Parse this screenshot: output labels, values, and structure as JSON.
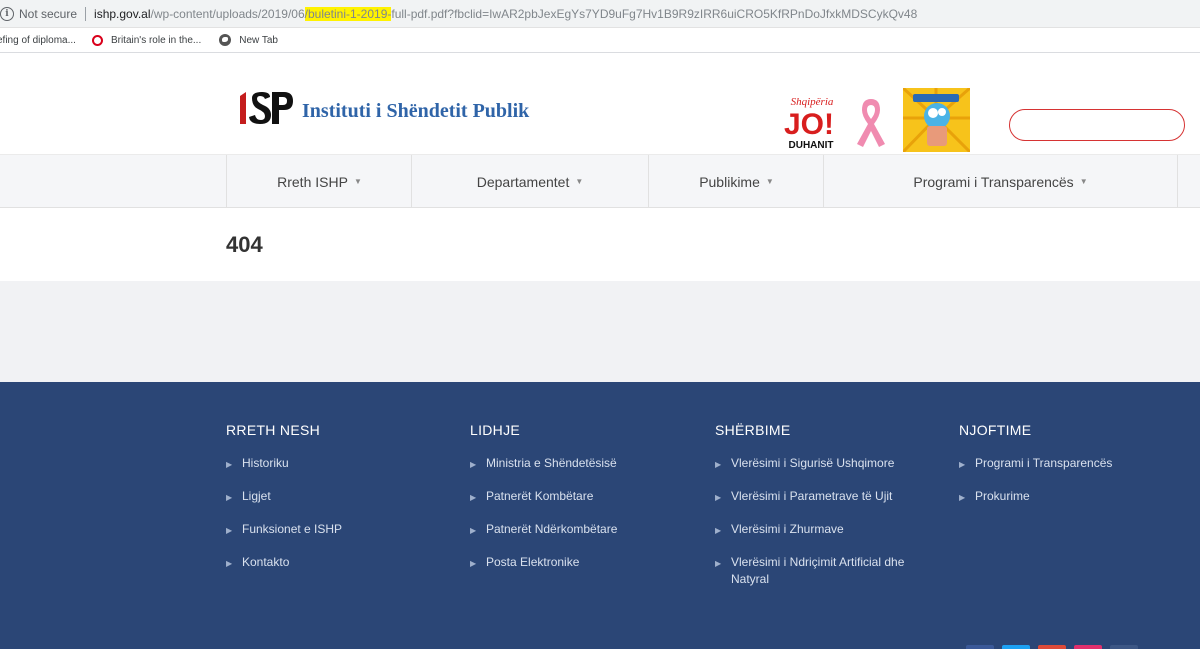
{
  "browser": {
    "security_label": "Not secure",
    "url_host": "ishp.gov.al",
    "url_path_before": "/wp-content/uploads/2019/06",
    "url_highlight": "/buletini-1-2019-",
    "url_path_after": "full-pdf.pdf?fbclid=IwAR2pbJexEgYs7YD9uFg7Hv1B9R9zIRR6uiCRO5KfRPnDoJfxkMDSCykQv48",
    "bookmarks": [
      {
        "label": "efing of diploma...",
        "icon": "page-icon"
      },
      {
        "label": "Britain's role in the...",
        "icon": "opera-icon"
      },
      {
        "label": "New Tab",
        "icon": "globe-icon"
      }
    ]
  },
  "site": {
    "logo_text": "ISP",
    "title": "Instituti i Shëndetit Publik",
    "badge_jo": {
      "top": "Shqipëria",
      "main": "JO!",
      "bottom": "DUHANIT"
    },
    "search_placeholder": "",
    "colors": {
      "brand_blue": "#2f64a8",
      "footer": "#2b4676",
      "search_border": "#d63333"
    }
  },
  "nav": {
    "items": [
      {
        "label": "Rreth ISHP"
      },
      {
        "label": "Departamentet"
      },
      {
        "label": "Publikime"
      },
      {
        "label": "Programi i Transparencës"
      }
    ]
  },
  "page": {
    "title": "404"
  },
  "footer": {
    "columns": [
      {
        "heading": "RRETH NESH",
        "links": [
          "Historiku",
          "Ligjet",
          "Funksionet e ISHP",
          "Kontakto"
        ]
      },
      {
        "heading": "LIDHJE",
        "links": [
          "Ministria e Shëndetësisë",
          "Patnerët Kombëtare",
          "Patnerët Ndërkombëtare",
          "Posta Elektronike"
        ]
      },
      {
        "heading": "SHËRBIME",
        "links": [
          "Vlerësimi i Sigurisë Ushqimore",
          "Vlerësimi i Parametrave të Ujit",
          "Vlerësimi i Zhurmave",
          "Vlerësimi i Ndriçimit Artificial dhe Natyral"
        ]
      },
      {
        "heading": "NJOFTIME",
        "links": [
          "Programi i Transparencës",
          "Prokurime"
        ]
      }
    ],
    "social_colors": [
      "#3b5998",
      "#1da1f2",
      "#dd4b39",
      "#e1306c",
      "#3d5785"
    ]
  }
}
